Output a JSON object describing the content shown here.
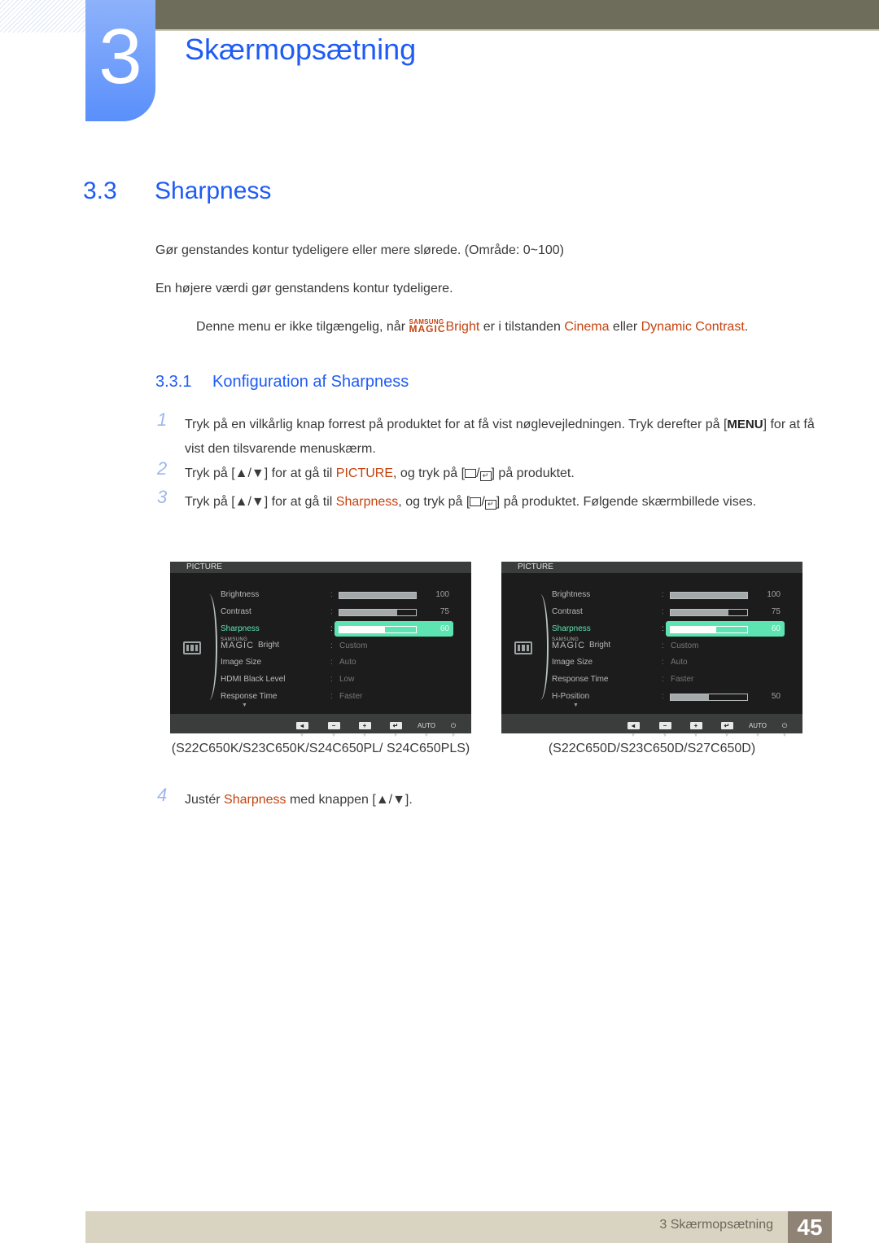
{
  "header": {
    "chapter_number": "3",
    "chapter_title": "Skærmopsætning"
  },
  "section": {
    "number": "3.3",
    "title": "Sharpness"
  },
  "paragraphs": [
    "Gør genstandes kontur tydeligere eller mere slørede. (Område: 0~100)",
    "En højere værdi gør genstandens kontur tydeligere."
  ],
  "note": {
    "before": "Denne menu er ikke tilgængelig, når ",
    "magic_small": "SAMSUNG",
    "magic_big": "MAGIC",
    "magic_word": "Bright",
    "middle": " er i tilstanden ",
    "mode1": "Cinema",
    "or": " eller ",
    "mode2": "Dynamic Contrast",
    "end": "."
  },
  "subsection": {
    "number": "3.3.1",
    "title": "Konfiguration af Sharpness"
  },
  "steps": [
    {
      "n": "1",
      "a": "Tryk på en vilkårlig knap forrest på produktet for at få vist nøglevejledningen. Tryk derefter på [",
      "key": "MENU",
      "b": "] for at få vist den tilsvarende menuskærm."
    },
    {
      "n": "2",
      "a": "Tryk på [▲/▼] for at gå til ",
      "hl": "PICTURE",
      "b": ", og tryk på [",
      "c": "] på produktet."
    },
    {
      "n": "3",
      "a": "Tryk på [▲/▼] for at gå til ",
      "hl": "Sharpness",
      "b": ", og tryk på [",
      "c": "] på produktet. Følgende skærmbillede vises."
    },
    {
      "n": "4",
      "a": "Justér ",
      "hl": "Sharpness",
      "b": " med knappen [▲/▼]."
    }
  ],
  "osd_left": {
    "header": "PICTURE",
    "rows": [
      {
        "label": "Brightness",
        "type": "bar",
        "value": 100
      },
      {
        "label": "Contrast",
        "type": "bar",
        "value": 75
      },
      {
        "label": "Sharpness",
        "type": "bar",
        "value": 60,
        "selected": true
      },
      {
        "label": "Bright",
        "type": "text",
        "value": "Custom",
        "magic": true
      },
      {
        "label": "Image Size",
        "type": "text",
        "value": "Auto"
      },
      {
        "label": "HDMI Black Level",
        "type": "text",
        "value": "Low"
      },
      {
        "label": "Response Time",
        "type": "text",
        "value": "Faster"
      }
    ],
    "caption": "(S22C650K/S23C650K/S24C650PL/ S24C650PLS)"
  },
  "osd_right": {
    "header": "PICTURE",
    "rows": [
      {
        "label": "Brightness",
        "type": "bar",
        "value": 100
      },
      {
        "label": "Contrast",
        "type": "bar",
        "value": 75
      },
      {
        "label": "Sharpness",
        "type": "bar",
        "value": 60,
        "selected": true
      },
      {
        "label": "Bright",
        "type": "text",
        "value": "Custom",
        "magic": true
      },
      {
        "label": "Image Size",
        "type": "text",
        "value": "Auto"
      },
      {
        "label": "Response Time",
        "type": "text",
        "value": "Faster"
      },
      {
        "label": "H-Position",
        "type": "bar",
        "value": 50
      }
    ],
    "caption": "(S22C650D/S23C650D/S27C650D)"
  },
  "osd_buttons": [
    {
      "icon": "left-arrow-icon",
      "glyph": "◂"
    },
    {
      "icon": "minus-icon",
      "glyph": "−"
    },
    {
      "icon": "plus-icon",
      "glyph": "+"
    },
    {
      "icon": "enter-icon",
      "glyph": "↵"
    },
    {
      "icon": "auto-icon",
      "glyph": "AUTO"
    },
    {
      "icon": "power-icon",
      "glyph": "⏻"
    }
  ],
  "footer": {
    "chapter_label": "3 Skærmopsætning",
    "page_number": "45"
  }
}
